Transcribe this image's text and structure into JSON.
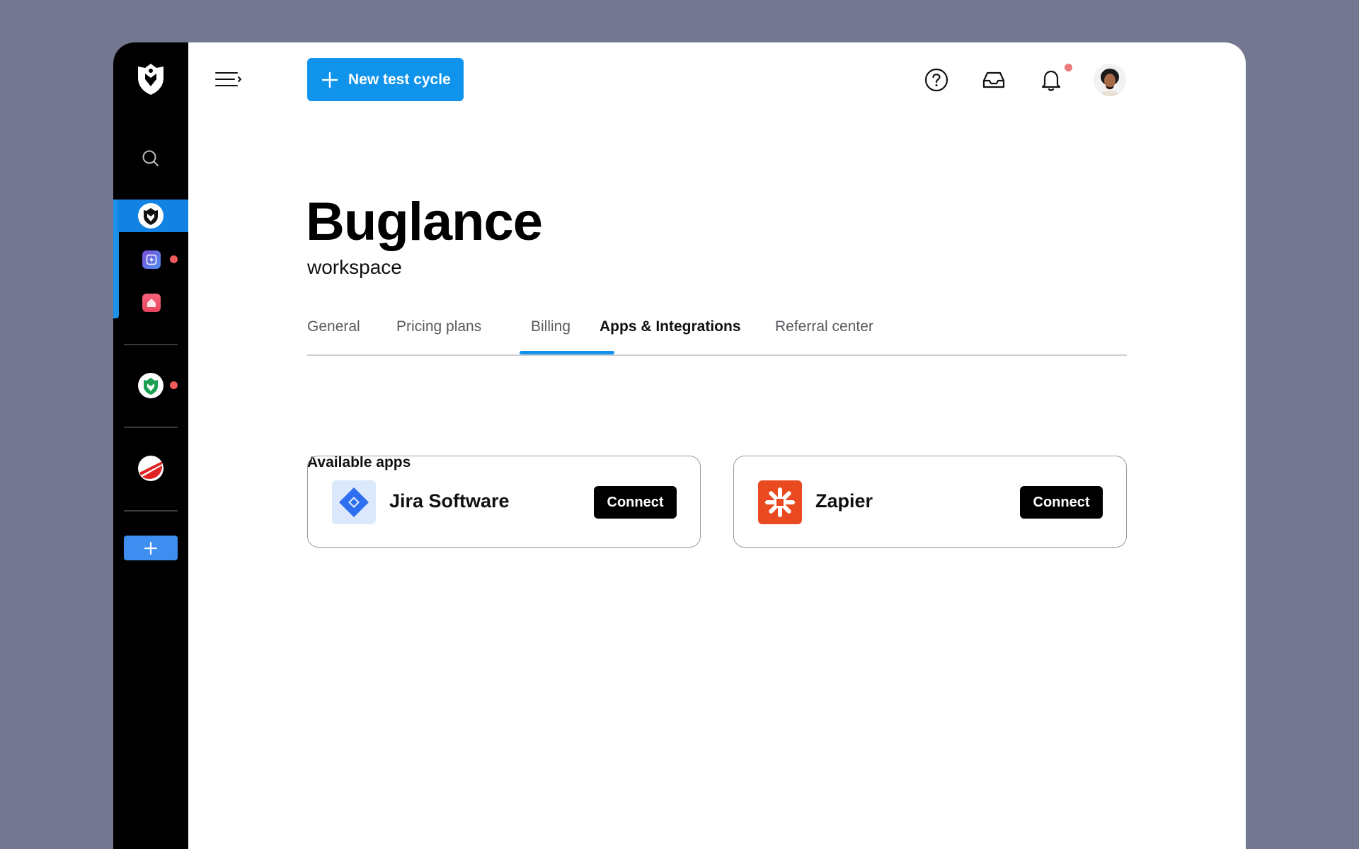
{
  "header": {
    "new_button_label": "New test cycle",
    "icons": [
      "help-icon",
      "inbox-icon",
      "bell-icon"
    ]
  },
  "page": {
    "title": "Buglance",
    "subtitle": "workspace"
  },
  "tabs": [
    {
      "label": "General"
    },
    {
      "label": "Pricing plans"
    },
    {
      "label": "Billing"
    },
    {
      "label": "Apps & Integrations",
      "active": true
    },
    {
      "label": "Referral center"
    }
  ],
  "apps_section": {
    "title": "Available apps",
    "apps": [
      {
        "name": "Jira Software",
        "button": "Connect",
        "icon": "jira-icon"
      },
      {
        "name": "Zapier",
        "button": "Connect",
        "icon": "zapier-icon"
      }
    ]
  },
  "colors": {
    "accent": "#1093eb",
    "sidebar": "#000000",
    "background": "#737790",
    "notification": "#f05a5a"
  }
}
